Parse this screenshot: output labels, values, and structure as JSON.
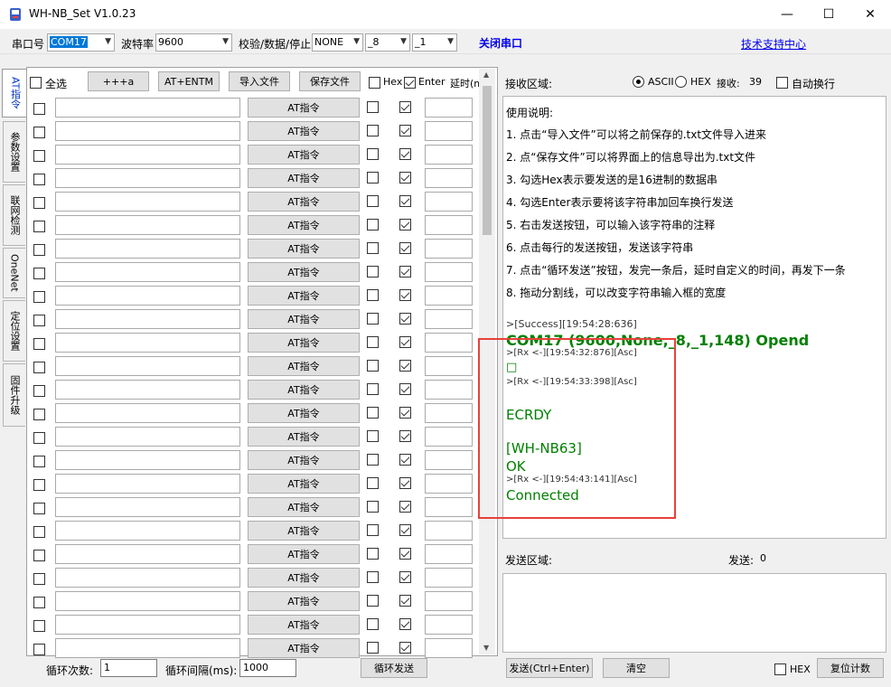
{
  "window": {
    "title": "WH-NB_Set V1.0.23",
    "minimize_glyph": "—",
    "maximize_glyph": "☐",
    "close_glyph": "✕"
  },
  "serial": {
    "port_label": "串口号",
    "port_value": "COM17",
    "baud_label": "波特率",
    "baud_value": "9600",
    "parity_label": "校验/数据/停止",
    "parity_value": "NONE",
    "data_bits_value": "_8",
    "stop_bits_value": "_1",
    "close_port_label": "关闭串口",
    "support_link": "技术支持中心"
  },
  "side_tabs": [
    {
      "label": "AT指令",
      "active": true
    },
    {
      "label": "参数设置",
      "active": false
    },
    {
      "label": "联网检测",
      "active": false
    },
    {
      "label": "OneNet",
      "active": false
    },
    {
      "label": "定位设置",
      "active": false
    },
    {
      "label": "固件升级",
      "active": false
    }
  ],
  "at_toolbar": {
    "select_all_label": "全选",
    "plus_button": "+++a",
    "entm_button": "AT+ENTM",
    "import_button": "导入文件",
    "save_button": "保存文件",
    "hex_label": "Hex",
    "enter_label": "Enter",
    "delay_label": "延时(ms)"
  },
  "command_rows": {
    "button_label": "AT指令",
    "count": 24
  },
  "loop": {
    "count_label": "循环次数:",
    "count_value": "1",
    "interval_label": "循环间隔(ms):",
    "interval_value": "1000",
    "loop_send_button": "循环发送"
  },
  "receive": {
    "area_label": "接收区域:",
    "ascii_label": "ASCII",
    "hex_label": "HEX",
    "ascii_selected": true,
    "rx_count_label": "接收:",
    "rx_count_value": "39",
    "auto_wrap_label": "自动换行",
    "instructions": [
      "使用说明:",
      "1. 点击“导入文件”可以将之前保存的.txt文件导入进来",
      "2. 点“保存文件”可以将界面上的信息导出为.txt文件",
      "3. 勾选Hex表示要发送的是16进制的数据串",
      "4. 勾选Enter表示要将该字符串加回车换行发送",
      "5. 右击发送按钮，可以输入该字符串的注释",
      "6. 点击每行的发送按钮，发送该字符串",
      "7. 点击“循环发送”按钮，发完一条后，延时自定义的时间，再发下一条",
      "8. 拖动分割线，可以改变字符串输入框的宽度"
    ],
    "log": {
      "success_line": ">[Success][19:54:28:636]",
      "opened_line": "COM17 (9600,None,_8,_1,148) Opend",
      "rx1": ">[Rx <-][19:54:32:876][Asc]",
      "box_char": "□",
      "rx2": ">[Rx <-][19:54:33:398][Asc]",
      "ecrdy": "ECRDY",
      "nb63": "[WH-NB63]",
      "ok": "OK",
      "rx3": ">[Rx <-][19:54:43:141][Asc]",
      "connected": "Connected"
    }
  },
  "send": {
    "area_label": "发送区域:",
    "tx_count_label": "发送:",
    "tx_count_value": "0",
    "send_button": "发送(Ctrl+Enter)",
    "clear_button": "清空",
    "hex_label": "HEX",
    "reset_button": "复位计数"
  },
  "colors": {
    "green_text": "#008000",
    "highlight_box": "#e8413a",
    "selection": "#0078d7"
  }
}
